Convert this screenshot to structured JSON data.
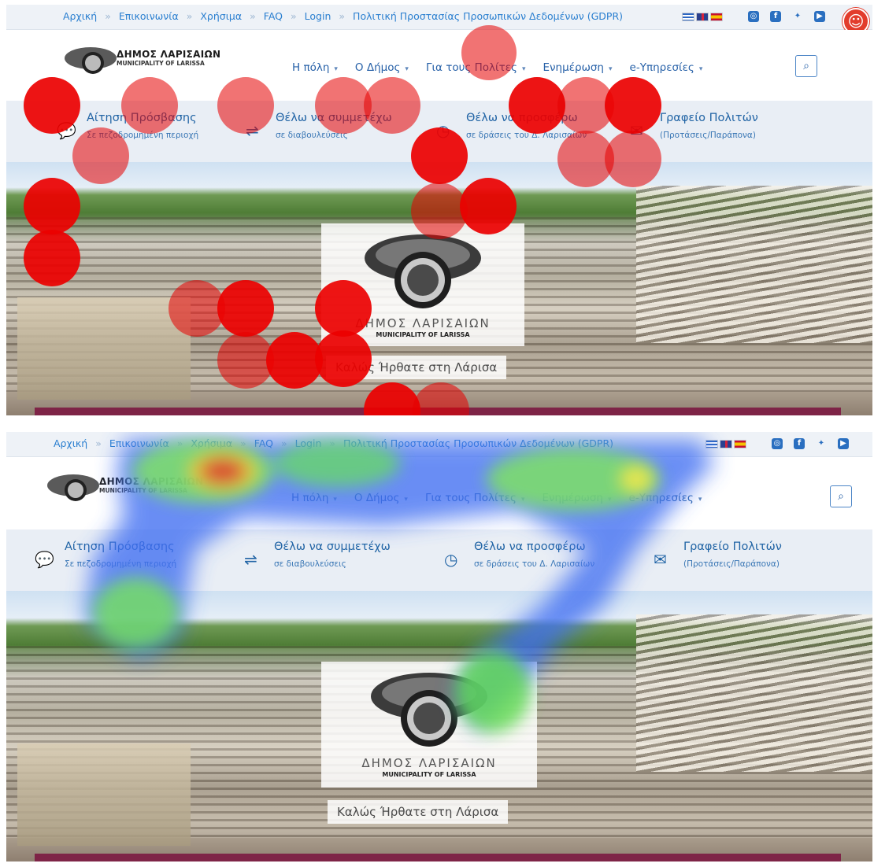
{
  "top_bar": {
    "links": [
      "Αρχική",
      "Επικοινωνία",
      "Χρήσιμα",
      "FAQ",
      "Login",
      "Πολιτική Προστασίας Προσωπικών Δεδομένων (GDPR)"
    ],
    "languages": [
      "Greek",
      "English",
      "Spanish"
    ],
    "social_icons": [
      "instagram-icon",
      "facebook-icon",
      "twitter-icon",
      "youtube-icon"
    ],
    "accessibility_icon": "accessibility-icon"
  },
  "header": {
    "logo_name": "ΔΗΜΟΣ ΛΑΡΙΣΑΙΩΝ",
    "logo_sub": "MUNICIPALITY OF LARISSA",
    "menu": [
      "Η πόλη",
      "Ο Δήμος",
      "Για τους Πολίτες",
      "Ενημέρωση",
      "e-Υπηρεσίες"
    ],
    "search_icon": "search-icon"
  },
  "quick_links": [
    {
      "title": "Αίτηση Πρόσβασης",
      "sub": "Σε πεζοδρομημένη περιοχή",
      "icon": "chat-icon"
    },
    {
      "title": "Θέλω να συμμετέχω",
      "sub": "σε διαβουλεύσεις",
      "icon": "signpost-icon"
    },
    {
      "title": "Θέλω να προσφέρω",
      "sub": "σε δράσεις του Δ. Λαρισαίων",
      "icon": "clock-icon"
    },
    {
      "title": "Γραφείο Πολιτών",
      "sub": "(Προτάσεις/Παράπονα)",
      "icon": "envelope-icon"
    }
  ],
  "hero": {
    "box_name": "ΔΗΜΟΣ ΛΑΡΙΣΑΙΩΝ",
    "box_sub": "MUNICIPALITY OF LARISSA",
    "welcome": "Καλώς Ήρθατε στη Λάρισα"
  },
  "colors": {
    "link_blue": "#2a7fd0",
    "menu_blue": "#2761a8",
    "quickbar_bg": "#e9eef5",
    "strip": "#7e2447",
    "fixation_red": "#e60000",
    "accessibility_red": "#e23c2c"
  }
}
